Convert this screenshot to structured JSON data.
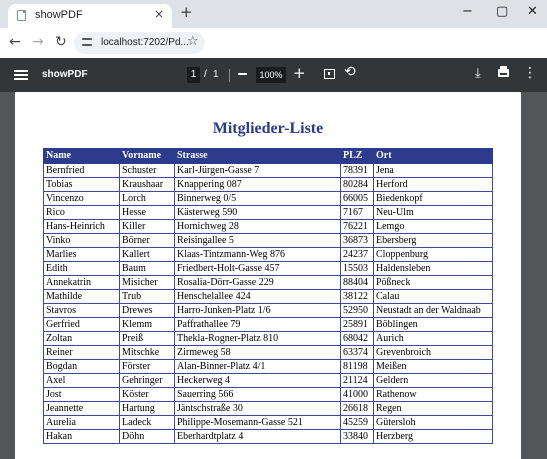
{
  "browser": {
    "tab_title": "showPDF",
    "tab_close": "×",
    "new_tab": "+",
    "window_minimize": "−",
    "window_maximize": "▢",
    "window_close": "✕",
    "back": "←",
    "forward": "→",
    "reload": "↻",
    "url": "localhost:7202/Pd...",
    "star": "☆"
  },
  "pdf_toolbar": {
    "title": "showPDF",
    "page_current": "1",
    "page_separator": "/",
    "page_total": "1",
    "zoom": "100%",
    "zoom_in": "+",
    "rotate": "⟲",
    "download": "⤓",
    "more": "⋮"
  },
  "document": {
    "heading": "Mitglieder-Liste",
    "columns": [
      "Name",
      "Vorname",
      "Strasse",
      "PLZ",
      "Ort"
    ],
    "rows": [
      [
        "Bernfried",
        "Schuster",
        "Karl-Jürgen-Gasse 7",
        "78391",
        "Jena"
      ],
      [
        "Tobias",
        "Kraushaar",
        "Knappering 087",
        "80284",
        "Herford"
      ],
      [
        "Vincenzo",
        "Lorch",
        "Binnerweg 0/5",
        "66005",
        "Biedenkopf"
      ],
      [
        "Rico",
        "Hesse",
        "Kästerweg 590",
        "7167",
        "Neu-Ulm"
      ],
      [
        "Hans-Heinrich",
        "Killer",
        "Hornichweg 28",
        "76221",
        "Lemgo"
      ],
      [
        "Vinko",
        "Börner",
        "Reisingallee 5",
        "36873",
        "Ebersberg"
      ],
      [
        "Marlies",
        "Kallert",
        "Klaas-Tintzmann-Weg 876",
        "24237",
        "Cloppenburg"
      ],
      [
        "Edith",
        "Baum",
        "Friedbert-Holt-Gasse 457",
        "15503",
        "Haldensleben"
      ],
      [
        "Annekatrin",
        "Misicher",
        "Rosalia-Dörr-Gasse 229",
        "88404",
        "Pößneck"
      ],
      [
        "Mathilde",
        "Trub",
        "Henschelallee 424",
        "38122",
        "Calau"
      ],
      [
        "Stavros",
        "Drewes",
        "Harro-Junken-Platz 1/6",
        "52950",
        "Neustadt an der Waldnaab"
      ],
      [
        "Gerfried",
        "Klemm",
        "Paffrathallee 79",
        "25891",
        "Böblingen"
      ],
      [
        "Zoltan",
        "Preiß",
        "Thekla-Rogner-Platz 810",
        "68042",
        "Aurich"
      ],
      [
        "Reiner",
        "Mitschke",
        "Zirmeweg 58",
        "63374",
        "Grevenbroich"
      ],
      [
        "Bogdan",
        "Förster",
        "Alan-Binner-Platz 4/1",
        "81198",
        "Meißen"
      ],
      [
        "Axel",
        "Gehringer",
        "Heckerweg 4",
        "21124",
        "Geldern"
      ],
      [
        "Jost",
        "Köster",
        "Sauerring 566",
        "41000",
        "Rathenow"
      ],
      [
        "Jeannette",
        "Hartung",
        "Jäntschstraße 30",
        "26618",
        "Regen"
      ],
      [
        "Aurelia",
        "Ladeck",
        "Philippe-Mosemann-Gasse 521",
        "45259",
        "Gütersloh"
      ],
      [
        "Hakan",
        "Döhn",
        "Eberhardtplatz 4",
        "33840",
        "Herzberg"
      ]
    ]
  }
}
